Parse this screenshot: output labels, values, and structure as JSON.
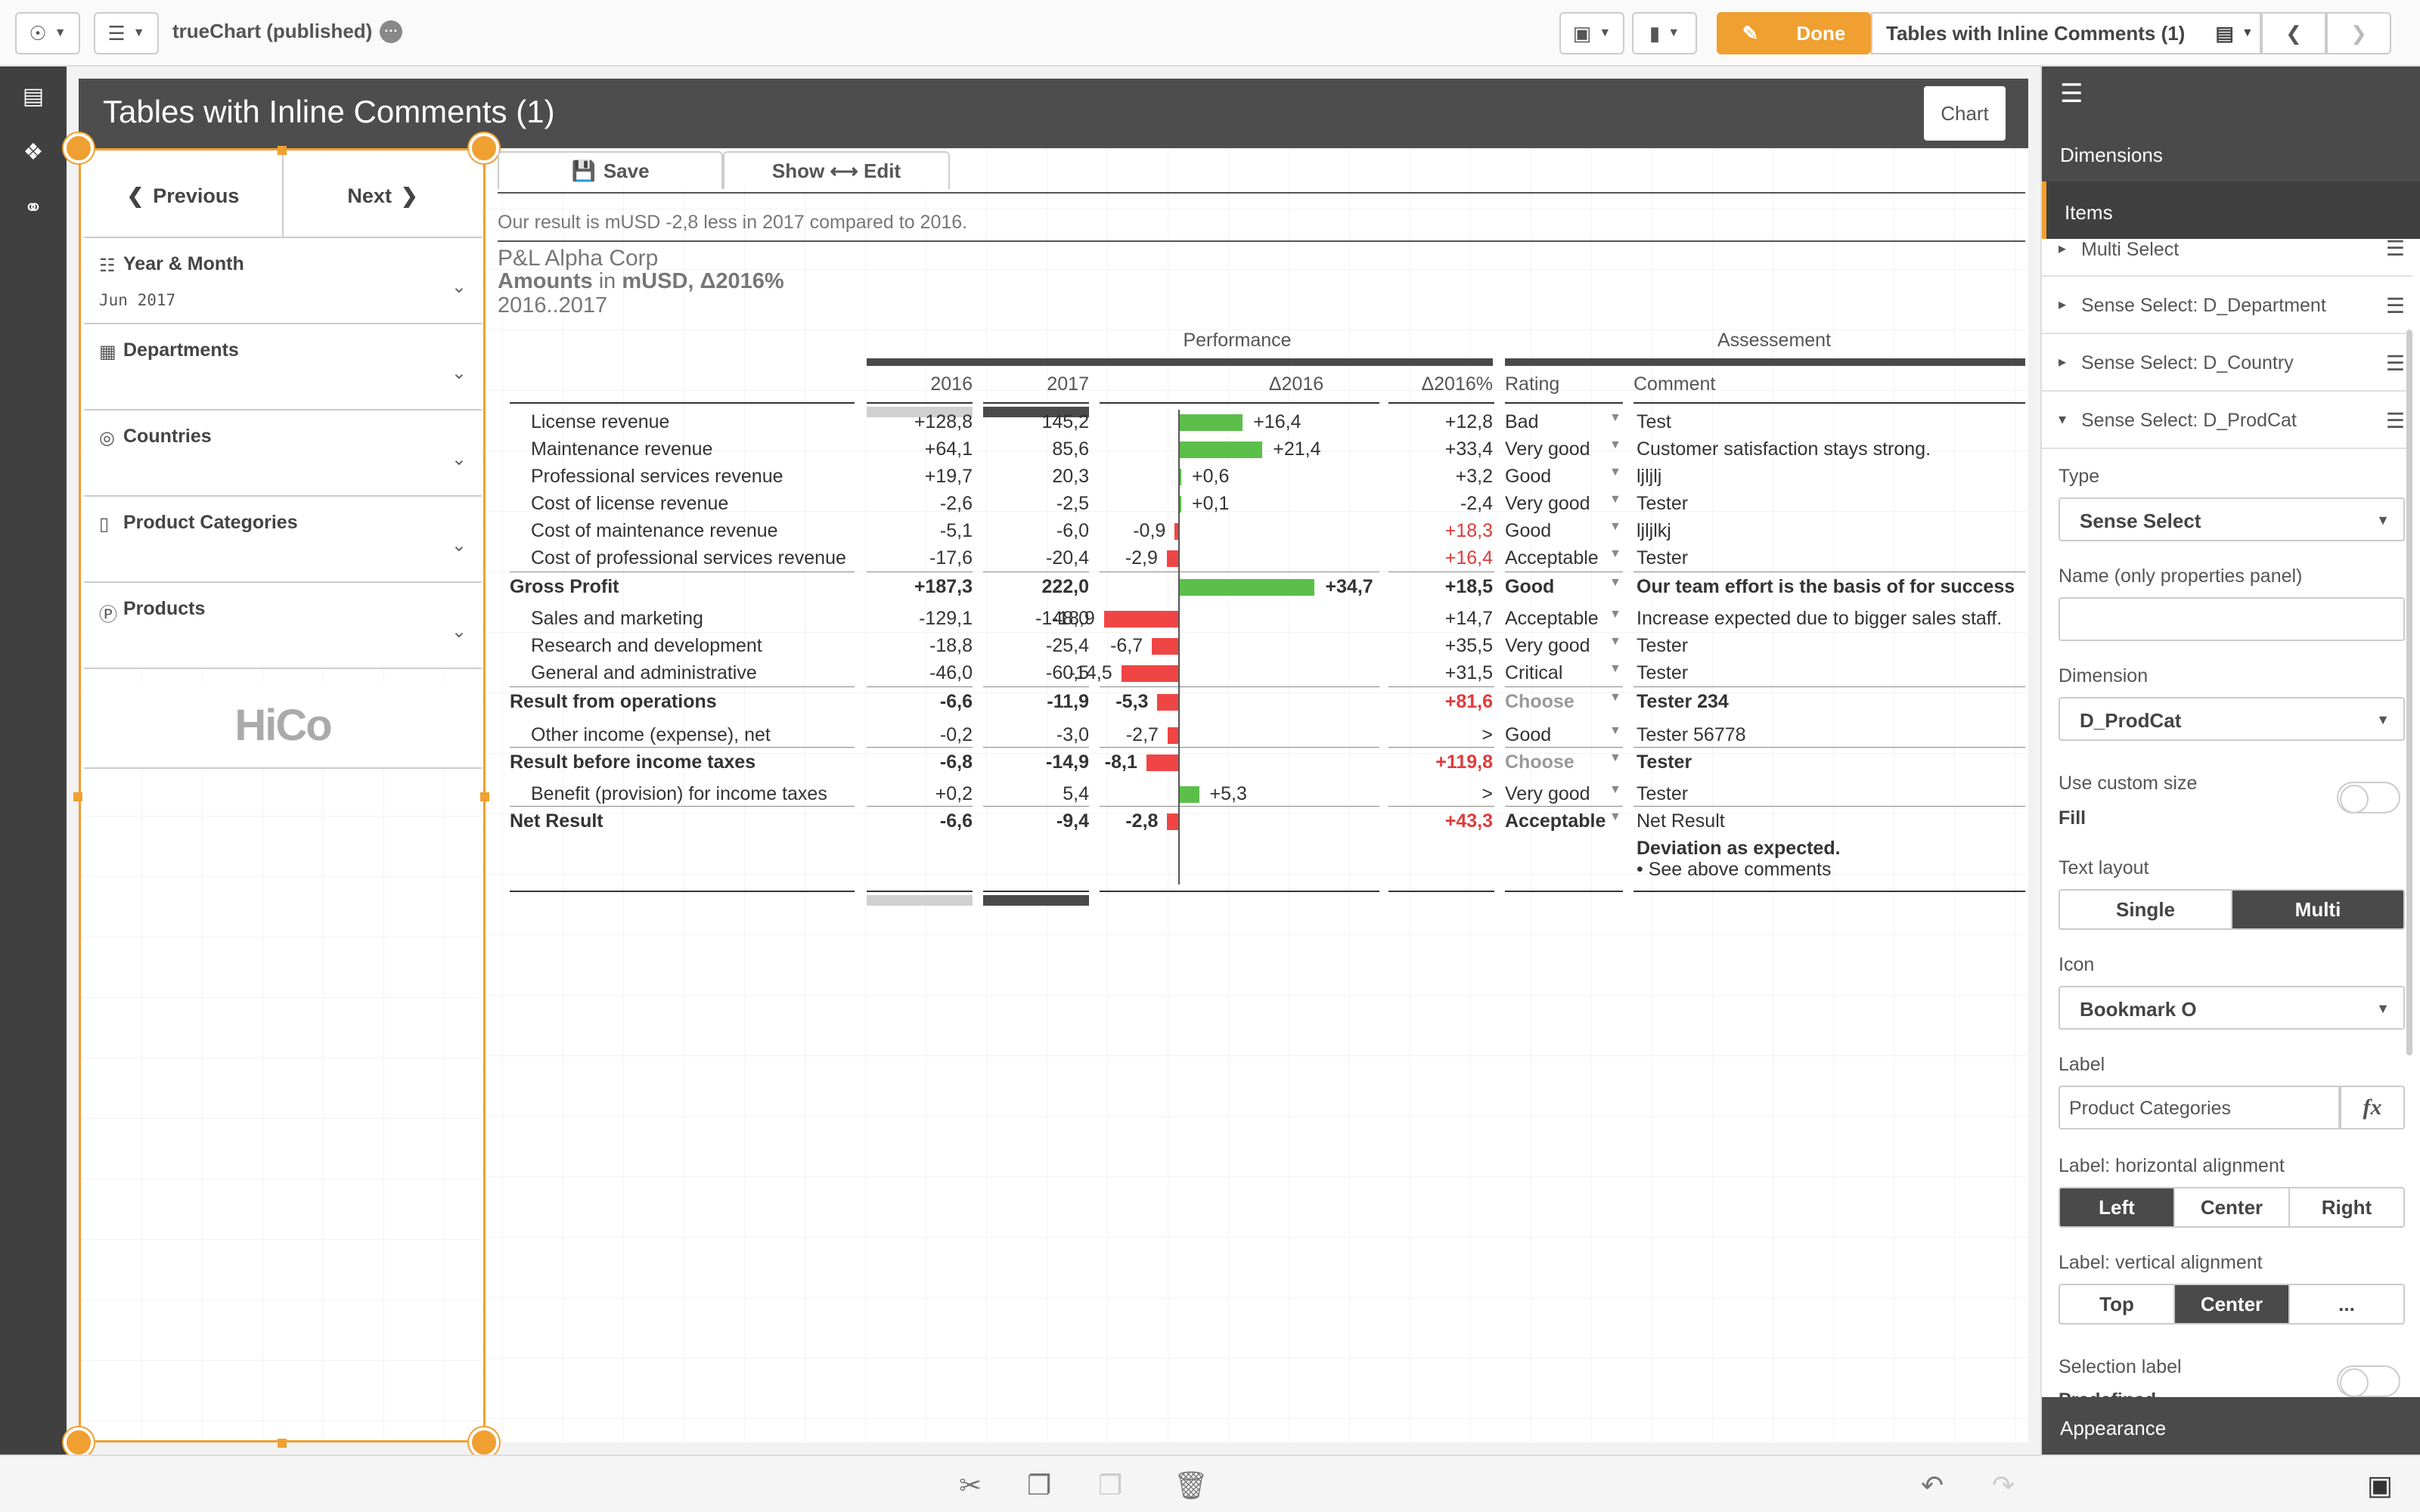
{
  "topbar": {
    "app_title": "trueChart (published)",
    "done_label": "Done",
    "sheet_selector": "Tables with Inline Comments (1)"
  },
  "sheet": {
    "title": "Tables with Inline Comments (1)",
    "logo_text": "Chart"
  },
  "filter": {
    "previous_label": "Previous",
    "next_label": "Next",
    "items": [
      {
        "label": "Year & Month",
        "value": "Jun 2017"
      },
      {
        "label": "Departments",
        "value": ""
      },
      {
        "label": "Countries",
        "value": ""
      },
      {
        "label": "Product Categories",
        "value": ""
      },
      {
        "label": "Products",
        "value": ""
      }
    ],
    "logo_text": "HiCo"
  },
  "chart": {
    "save_label": "Save",
    "showedit_label": "Show ⟷ Edit",
    "summary": "Our result is mUSD -2,8 less in 2017 compared to 2016.",
    "company": "P&L Alpha Corp",
    "amounts_line_a": "Amounts",
    "amounts_line_b": "in",
    "amounts_line_c": "mUSD, Δ2016%",
    "period": "2016..2017",
    "group_performance": "Performance",
    "group_assessment": "Assessement",
    "col_2016": "2016",
    "col_2017": "2017",
    "col_delta": "Δ2016",
    "col_deltapct": "Δ2016%",
    "col_rating": "Rating",
    "col_comment": "Comment",
    "net_comment_2": "Deviation as expected.",
    "net_comment_3": "• See above comments"
  },
  "chart_data": {
    "type": "table",
    "columns": [
      "",
      "2016",
      "2017",
      "Δ2016",
      "Δ2016%",
      "Rating",
      "Comment"
    ],
    "rows": [
      {
        "label": "License revenue",
        "v2016": "+128,8",
        "v2017": "145,2",
        "delta": "+16,4",
        "delta_val": 16.4,
        "pct": "+12,8",
        "rating": "Bad",
        "comment": "Test",
        "bold": false,
        "pct_red": false
      },
      {
        "label": "Maintenance revenue",
        "v2016": "+64,1",
        "v2017": "85,6",
        "delta": "+21,4",
        "delta_val": 21.4,
        "pct": "+33,4",
        "rating": "Very good",
        "comment": "Customer satisfaction stays strong.",
        "bold": false,
        "pct_red": false
      },
      {
        "label": "Professional services revenue",
        "v2016": "+19,7",
        "v2017": "20,3",
        "delta": "+0,6",
        "delta_val": 0.6,
        "pct": "+3,2",
        "rating": "Good",
        "comment": "ljljlj",
        "bold": false,
        "pct_red": false
      },
      {
        "label": "Cost of license revenue",
        "v2016": "-2,6",
        "v2017": "-2,5",
        "delta": "+0,1",
        "delta_val": 0.1,
        "pct": "-2,4",
        "rating": "Very good",
        "comment": "Tester",
        "bold": false,
        "pct_red": false
      },
      {
        "label": "Cost of maintenance revenue",
        "v2016": "-5,1",
        "v2017": "-6,0",
        "delta": "-0,9",
        "delta_val": -0.9,
        "pct": "+18,3",
        "rating": "Good",
        "comment": "ljljlkj",
        "bold": false,
        "pct_red": true
      },
      {
        "label": "Cost of professional services revenue",
        "v2016": "-17,6",
        "v2017": "-20,4",
        "delta": "-2,9",
        "delta_val": -2.9,
        "pct": "+16,4",
        "rating": "Acceptable",
        "comment": "Tester",
        "bold": false,
        "pct_red": true
      },
      {
        "label": "Gross Profit",
        "v2016": "+187,3",
        "v2017": "222,0",
        "delta": "+34,7",
        "delta_val": 34.7,
        "pct": "+18,5",
        "rating": "Good",
        "comment": "Our team effort is the basis of for success",
        "bold": true,
        "pct_red": false
      },
      {
        "label": "Sales and marketing",
        "v2016": "-129,1",
        "v2017": "-148,0",
        "delta": "-18,9",
        "delta_val": -18.9,
        "pct": "+14,7",
        "rating": "Acceptable",
        "comment": "Increase expected due to bigger sales staff.",
        "bold": false,
        "pct_red": false
      },
      {
        "label": "Research and development",
        "v2016": "-18,8",
        "v2017": "-25,4",
        "delta": "-6,7",
        "delta_val": -6.7,
        "pct": "+35,5",
        "rating": "Very good",
        "comment": "Tester",
        "bold": false,
        "pct_red": false
      },
      {
        "label": "General and administrative",
        "v2016": "-46,0",
        "v2017": "-60,5",
        "delta": "-14,5",
        "delta_val": -14.5,
        "pct": "+31,5",
        "rating": "Critical",
        "comment": "Tester",
        "bold": false,
        "pct_red": false
      },
      {
        "label": "Result from operations",
        "v2016": "-6,6",
        "v2017": "-11,9",
        "delta": "-5,3",
        "delta_val": -5.3,
        "pct": "+81,6",
        "rating": "Choose",
        "comment": "Tester 234",
        "bold": true,
        "pct_red": true
      },
      {
        "label": "Other income (expense), net",
        "v2016": "-0,2",
        "v2017": "-3,0",
        "delta": "-2,7",
        "delta_val": -2.7,
        "pct": ">",
        "rating": "Good",
        "comment": "Tester 56778",
        "bold": false,
        "pct_red": false
      },
      {
        "label": "Result before income taxes",
        "v2016": "-6,8",
        "v2017": "-14,9",
        "delta": "-8,1",
        "delta_val": -8.1,
        "pct": "+119,8",
        "rating": "Choose",
        "comment": "Tester",
        "bold": true,
        "pct_red": true
      },
      {
        "label": "Benefit (provision) for income taxes",
        "v2016": "+0,2",
        "v2017": "5,4",
        "delta": "+5,3",
        "delta_val": 5.3,
        "pct": ">",
        "rating": "Very good",
        "comment": "Tester",
        "bold": false,
        "pct_red": false
      },
      {
        "label": "Net Result",
        "v2016": "-6,6",
        "v2017": "-9,4",
        "delta": "-2,8",
        "delta_val": -2.8,
        "pct": "+43,3",
        "rating": "Acceptable",
        "comment": "Net Result",
        "bold": true,
        "pct_red": true
      }
    ],
    "bar_colors": {
      "positive": "#5cbf4a",
      "negative": "#f04545"
    }
  },
  "panel": {
    "tab_dimensions": "Dimensions",
    "tab_items": "Items",
    "items": [
      {
        "label": "Multi Select"
      },
      {
        "label": "Sense Select: D_Department"
      },
      {
        "label": "Sense Select: D_Country"
      },
      {
        "label": "Sense Select: D_ProdCat"
      }
    ],
    "type_label": "Type",
    "type_value": "Sense Select",
    "name_label": "Name (only properties panel)",
    "name_value": "",
    "dimension_label": "Dimension",
    "dimension_value": "D_ProdCat",
    "custom_size_label": "Use custom size",
    "custom_size_value": "Fill",
    "text_layout_label": "Text layout",
    "text_layout_single": "Single",
    "text_layout_multi": "Multi",
    "icon_label": "Icon",
    "icon_value": "Bookmark O",
    "label_label": "Label",
    "label_value": "Product Categories",
    "fx_label": "fx",
    "halign_label": "Label: horizontal alignment",
    "halign_left": "Left",
    "halign_center": "Center",
    "halign_right": "Right",
    "valign_label": "Label: vertical alignment",
    "valign_top": "Top",
    "valign_center": "Center",
    "valign_more": "...",
    "selection_label": "Selection label",
    "selection_value": "Predefined",
    "appearance": "Appearance"
  },
  "colors": {
    "accent": "#f0a030",
    "dark": "#4a4a4a"
  }
}
